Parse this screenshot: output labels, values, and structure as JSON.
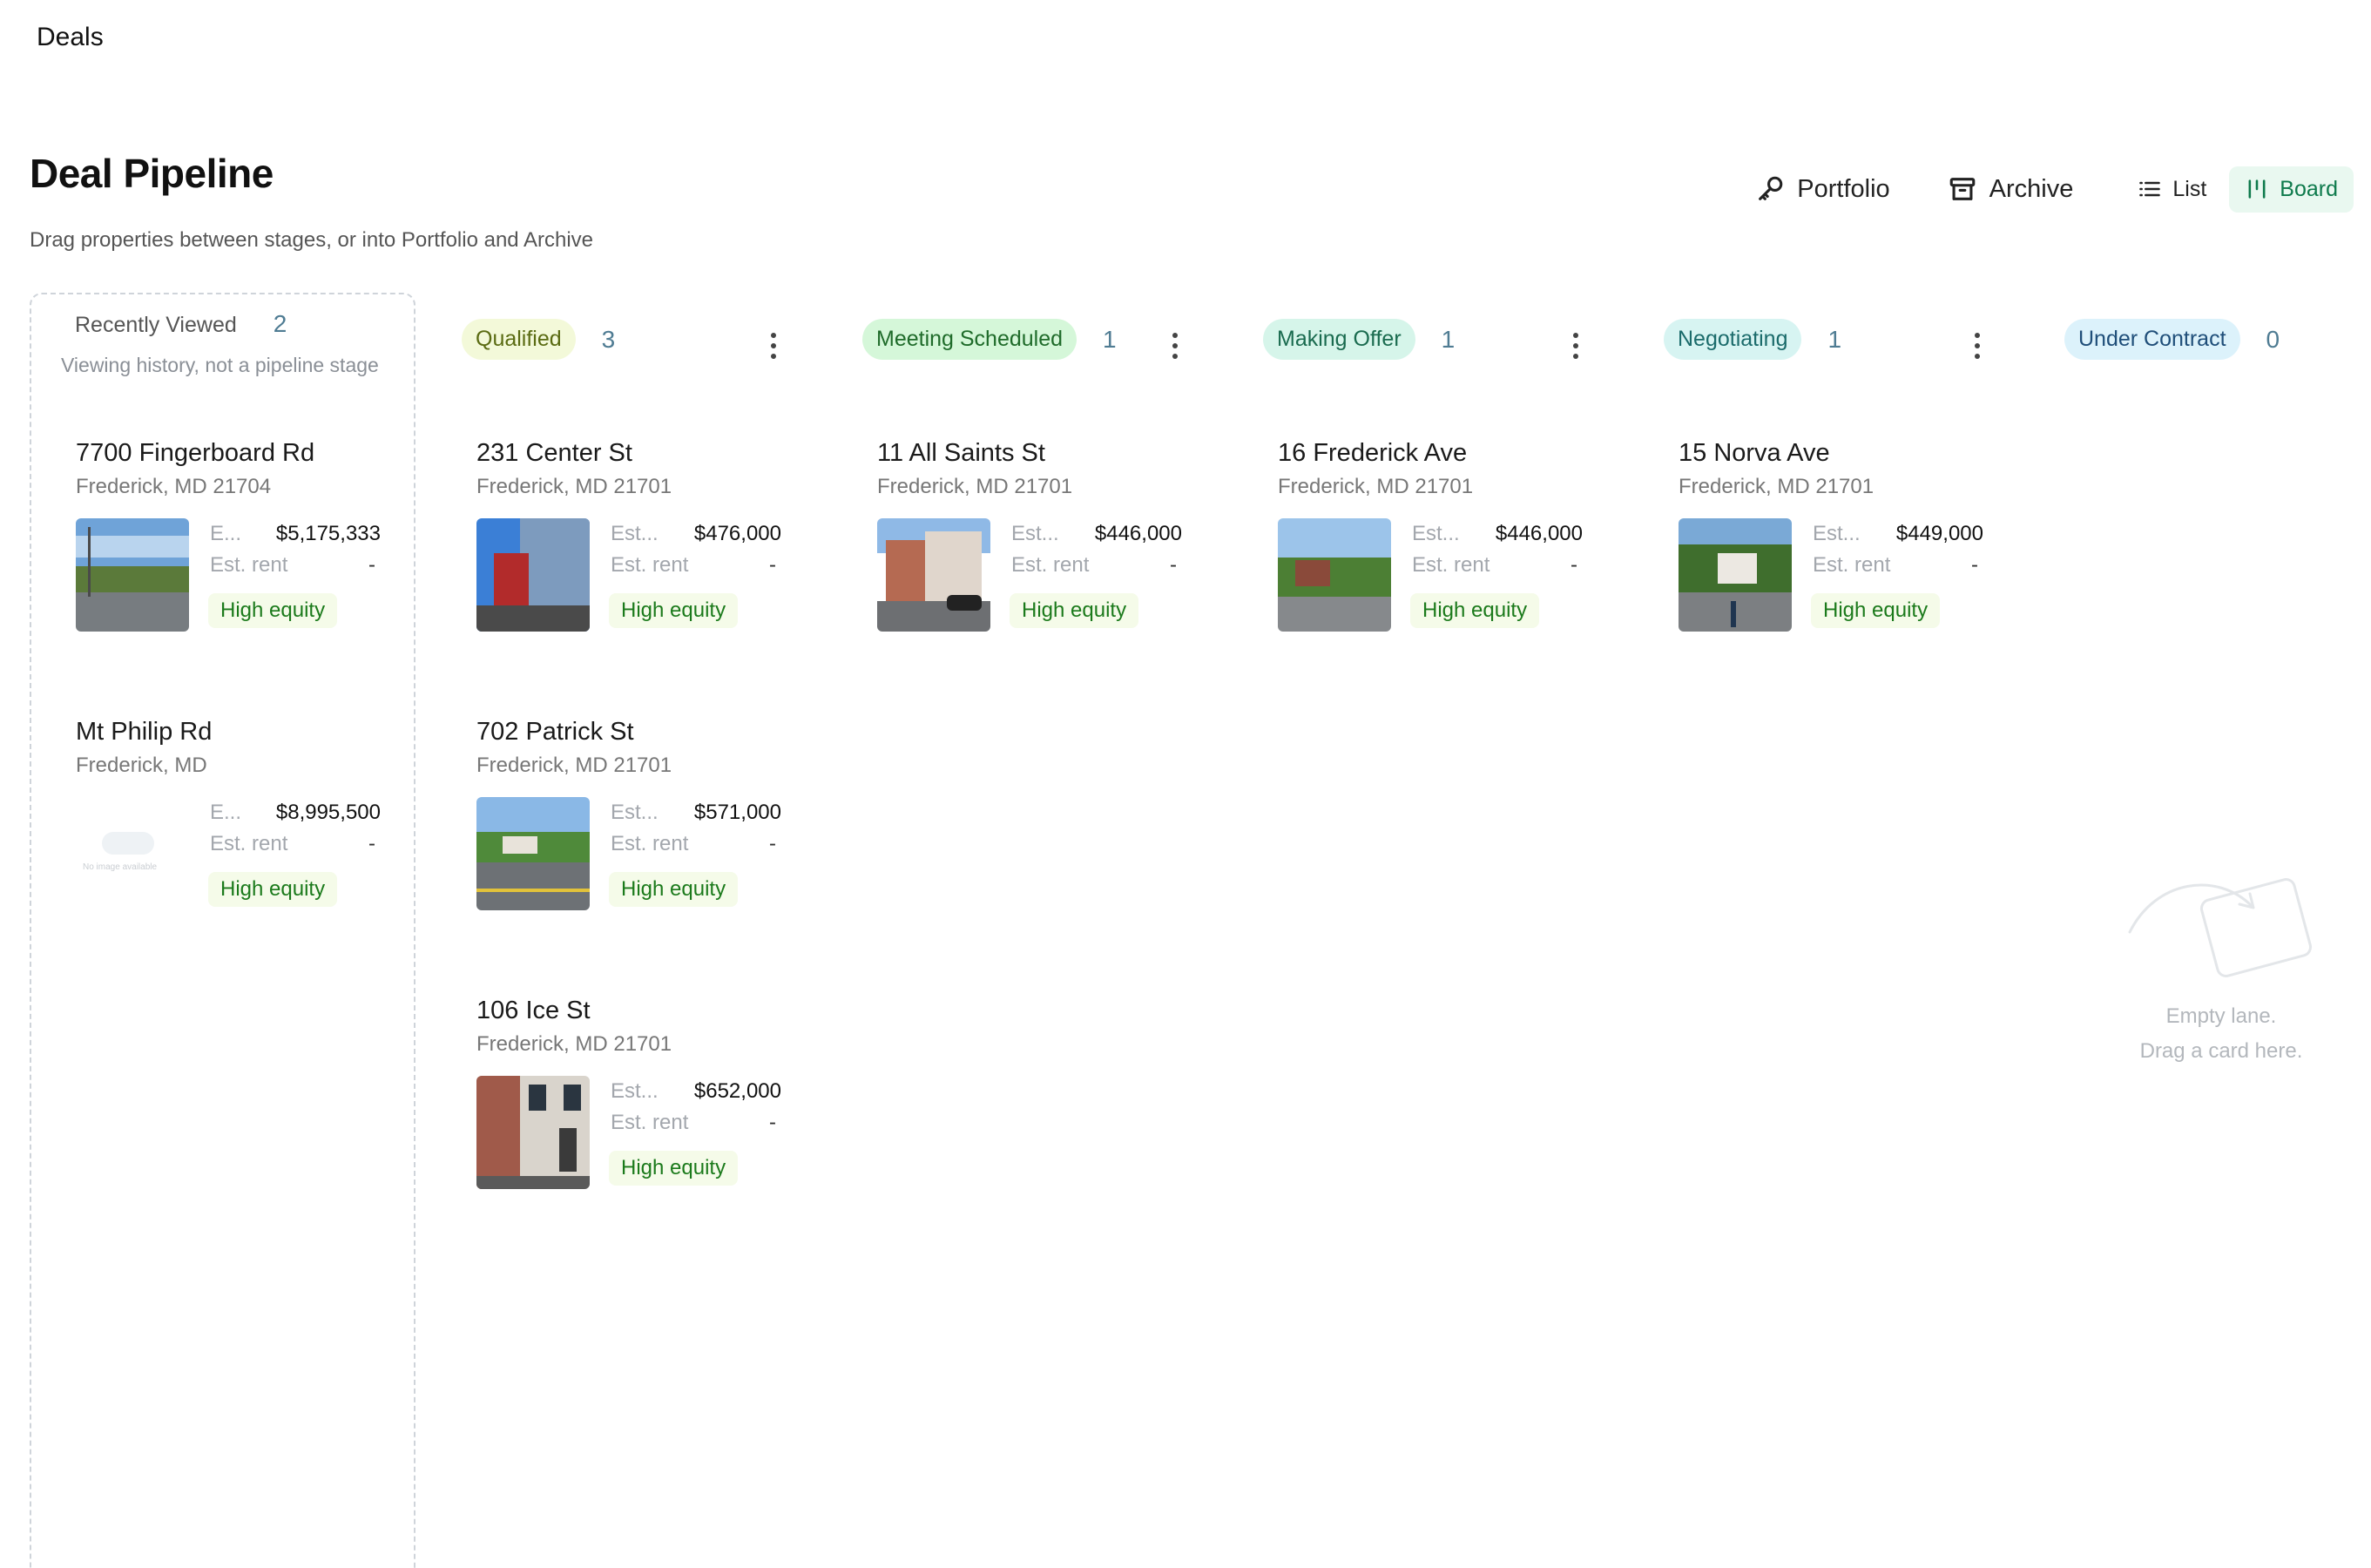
{
  "topbar": {
    "title": "Deals"
  },
  "header": {
    "title": "Deal Pipeline",
    "subtitle": "Drag properties between stages, or into Portfolio and Archive"
  },
  "actions": {
    "portfolio": {
      "label": "Portfolio",
      "icon": "key-icon"
    },
    "archive": {
      "label": "Archive",
      "icon": "archive-box-icon"
    },
    "list": {
      "label": "List",
      "icon": "list-icon"
    },
    "board": {
      "label": "Board",
      "icon": "board-columns-icon",
      "active": true
    }
  },
  "recent": {
    "title": "Recently Viewed",
    "count": "2",
    "subtitle": "Viewing history, not a pipeline stage",
    "cards": [
      {
        "title": "7700 Fingerboard Rd",
        "address": "Frederick, MD 21704",
        "est_label": "E...",
        "est_value": "$5,175,333",
        "rent_label": "Est. rent",
        "rent_value": "-",
        "badge": "High equity"
      },
      {
        "title": "Mt Philip Rd",
        "address": "Frederick, MD",
        "est_label": "E...",
        "est_value": "$8,995,500",
        "rent_label": "Est. rent",
        "rent_value": "-",
        "badge": "High equity",
        "no_image": "No image available"
      }
    ]
  },
  "stages": [
    {
      "name": "Qualified",
      "count": "3",
      "bg": "#f3f9d9",
      "fg": "#5a6b12"
    },
    {
      "name": "Meeting Scheduled",
      "count": "1",
      "bg": "#d5f7d9",
      "fg": "#1f6b2a"
    },
    {
      "name": "Making Offer",
      "count": "1",
      "bg": "#d6f5ea",
      "fg": "#1a6b4f"
    },
    {
      "name": "Negotiating",
      "count": "1",
      "bg": "#d7f4f2",
      "fg": "#1b6b6b"
    },
    {
      "name": "Under Contract",
      "count": "0",
      "bg": "#dcf2fb",
      "fg": "#1f4e79"
    }
  ],
  "cards": {
    "qualified": [
      {
        "title": "231 Center St",
        "address": "Frederick, MD 21701",
        "est_label": "Est...",
        "est_value": "$476,000",
        "rent_label": "Est. rent",
        "rent_value": "-",
        "badge": "High equity"
      },
      {
        "title": "702 Patrick St",
        "address": "Frederick, MD 21701",
        "est_label": "Est...",
        "est_value": "$571,000",
        "rent_label": "Est. rent",
        "rent_value": "-",
        "badge": "High equity"
      },
      {
        "title": "106 Ice St",
        "address": "Frederick, MD 21701",
        "est_label": "Est...",
        "est_value": "$652,000",
        "rent_label": "Est. rent",
        "rent_value": "-",
        "badge": "High equity"
      }
    ],
    "meeting": [
      {
        "title": "11 All Saints St",
        "address": "Frederick, MD 21701",
        "est_label": "Est...",
        "est_value": "$446,000",
        "rent_label": "Est. rent",
        "rent_value": "-",
        "badge": "High equity"
      }
    ],
    "offer": [
      {
        "title": "16 Frederick Ave",
        "address": "Frederick, MD 21701",
        "est_label": "Est...",
        "est_value": "$446,000",
        "rent_label": "Est. rent",
        "rent_value": "-",
        "badge": "High equity"
      }
    ],
    "negotiating": [
      {
        "title": "15 Norva Ave",
        "address": "Frederick, MD 21701",
        "est_label": "Est...",
        "est_value": "$449,000",
        "rent_label": "Est. rent",
        "rent_value": "-",
        "badge": "High equity"
      }
    ]
  },
  "empty_lane": {
    "line1": "Empty lane.",
    "line2": "Drag a card here."
  }
}
